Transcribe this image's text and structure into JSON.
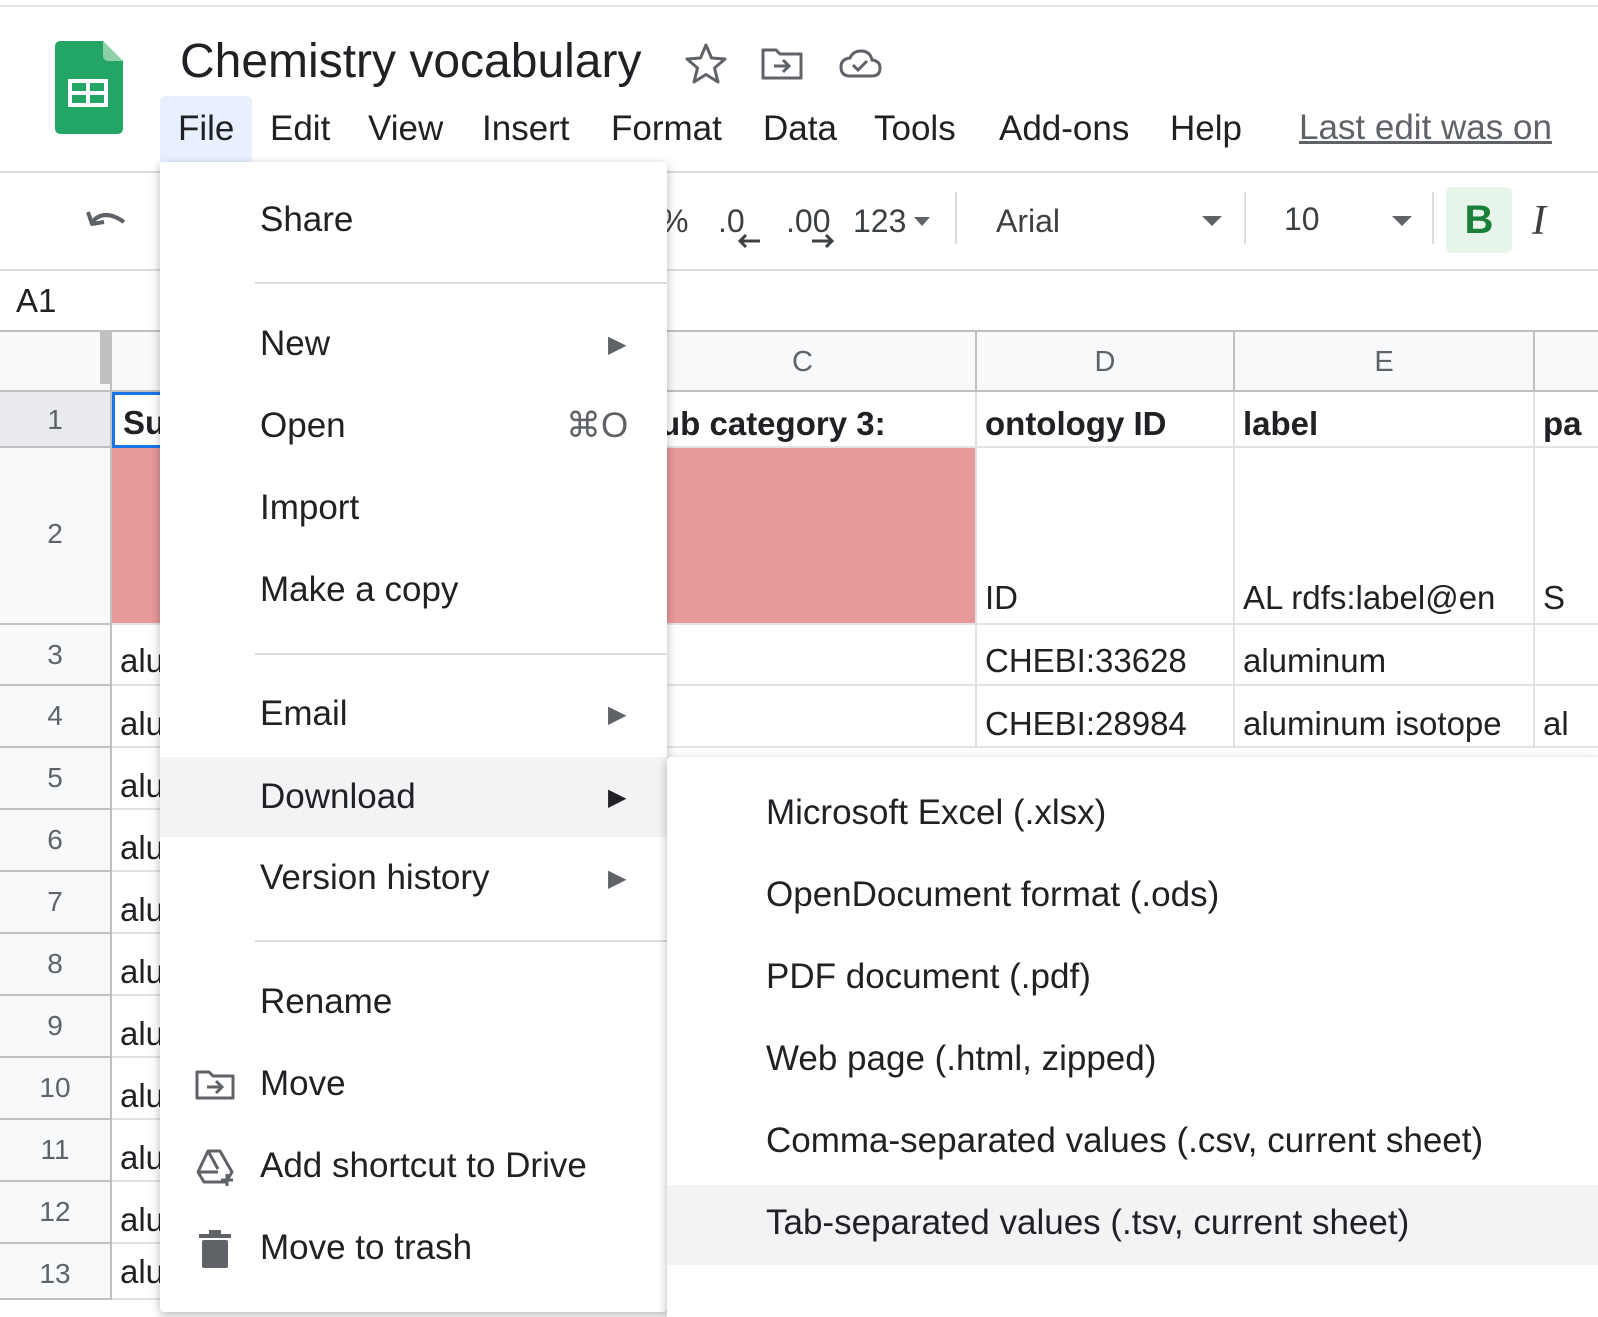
{
  "header": {
    "title": "Chemistry vocabulary",
    "icons": [
      "star-icon",
      "move-to-folder-icon",
      "cloud-saved-icon"
    ],
    "menus": [
      "File",
      "Edit",
      "View",
      "Insert",
      "Format",
      "Data",
      "Tools",
      "Add-ons",
      "Help"
    ],
    "active_menu": "File",
    "last_edit": "Last edit was on"
  },
  "toolbar": {
    "percent": "%",
    "decrease_decimal": ".0",
    "increase_decimal": ".00",
    "number_format": "123",
    "font": "Arial",
    "font_size": "10",
    "bold": "B",
    "italic": "I"
  },
  "name_box": "A1",
  "grid": {
    "columns": [
      "C",
      "D",
      "E"
    ],
    "rows": [
      "1",
      "2",
      "3",
      "4",
      "5",
      "6",
      "7",
      "8",
      "9",
      "10",
      "11",
      "12",
      "13"
    ],
    "col_b_partial": [
      "Su",
      "",
      "alu",
      "alu",
      "alu",
      "alu",
      "alu",
      "alu",
      "alu",
      "alu",
      "alu",
      "alu",
      "alu"
    ],
    "row1": {
      "c": "ub category 3:",
      "d": "ontology ID",
      "e": "label",
      "f": "pa"
    },
    "row2": {
      "d": "ID",
      "e": "AL rdfs:label@en",
      "f": "S"
    },
    "row3": {
      "d": "CHEBI:33628",
      "e": "aluminum"
    },
    "row4": {
      "d": "CHEBI:28984",
      "e": "aluminum isotope",
      "f": "al"
    },
    "highlight_color": "#e8999a"
  },
  "file_menu": {
    "share": "Share",
    "new": "New",
    "open": "Open",
    "open_shortcut": "⌘O",
    "import": "Import",
    "make_copy": "Make a copy",
    "email": "Email",
    "download": "Download",
    "version_history": "Version history",
    "rename": "Rename",
    "move": "Move",
    "add_shortcut": "Add shortcut to Drive",
    "move_to_trash": "Move to trash"
  },
  "download_menu": {
    "items": [
      "Microsoft Excel (.xlsx)",
      "OpenDocument format (.ods)",
      "PDF document (.pdf)",
      "Web page (.html, zipped)",
      "Comma-separated values (.csv, current sheet)",
      "Tab-separated values (.tsv, current sheet)"
    ],
    "highlighted_index": 5
  },
  "colors": {
    "sheets_green": "#23a566",
    "menu_hover": "#f1f3f4",
    "active_menu_bg": "#e8f0fe",
    "bold_bg": "#e6f4ea"
  }
}
